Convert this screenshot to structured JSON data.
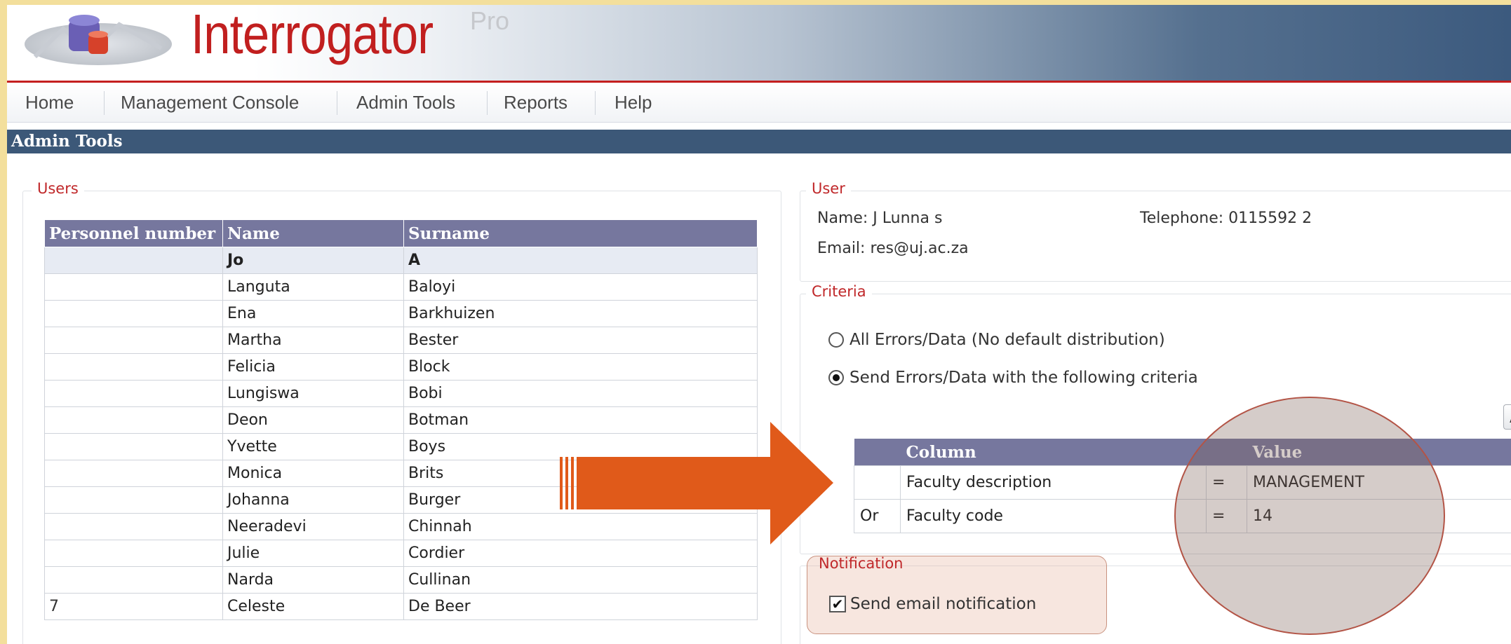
{
  "app": {
    "brand": "Interrogator",
    "brand_sup": "Pro"
  },
  "nav": {
    "items": [
      "Home",
      "Management Console",
      "Admin Tools",
      "Reports",
      "Help"
    ]
  },
  "page_title": "Admin Tools",
  "users_panel": {
    "legend": "Users",
    "columns": [
      "Personnel number",
      "Name",
      "Surname"
    ],
    "rows": [
      {
        "pn": "",
        "name": "Jo",
        "surname": "A"
      },
      {
        "pn": "",
        "name": "Languta",
        "surname": "Baloyi"
      },
      {
        "pn": "",
        "name": "Ena",
        "surname": "Barkhuizen"
      },
      {
        "pn": "",
        "name": "Martha",
        "surname": "Bester"
      },
      {
        "pn": "",
        "name": "Felicia",
        "surname": "Block"
      },
      {
        "pn": "",
        "name": "Lungiswa",
        "surname": "Bobi"
      },
      {
        "pn": "",
        "name": "Deon",
        "surname": "Botman"
      },
      {
        "pn": "",
        "name": "Yvette",
        "surname": "Boys"
      },
      {
        "pn": "",
        "name": "Monica",
        "surname": "Brits"
      },
      {
        "pn": "",
        "name": "Johanna",
        "surname": "Burger"
      },
      {
        "pn": "",
        "name": "Neeradevi",
        "surname": "Chinnah"
      },
      {
        "pn": "",
        "name": "Julie",
        "surname": "Cordier"
      },
      {
        "pn": "",
        "name": "Narda",
        "surname": "Cullinan"
      },
      {
        "pn": "7",
        "name": "Celeste",
        "surname": "De Beer"
      }
    ]
  },
  "user_panel": {
    "legend": "User",
    "name_line": "Name: J  Lunna   s",
    "telephone_line": "Telephone: 0115592   2",
    "email_line": "Email:   res@uj.ac.za"
  },
  "criteria_panel": {
    "legend": "Criteria",
    "option_all": "All Errors/Data (No default distribution)",
    "option_send": "Send Errors/Data with the following criteria",
    "selected": "send",
    "add_button": "A",
    "columns": [
      "",
      "Column",
      "",
      "Value"
    ],
    "rows": [
      {
        "conj": "",
        "column": "Faculty description",
        "op": "=",
        "value": "MANAGEMENT"
      },
      {
        "conj": "Or",
        "column": "Faculty code",
        "op": "=",
        "value": "14"
      }
    ]
  },
  "notification_panel": {
    "legend": "Notification",
    "checkbox_label": "Send email notification",
    "checked": true
  },
  "colors": {
    "brand_red": "#c11f1f",
    "title_bar": "#3c5878",
    "table_header": "#76779e",
    "arrow": "#e05a1a",
    "slide_bg": "#f3df9c"
  }
}
